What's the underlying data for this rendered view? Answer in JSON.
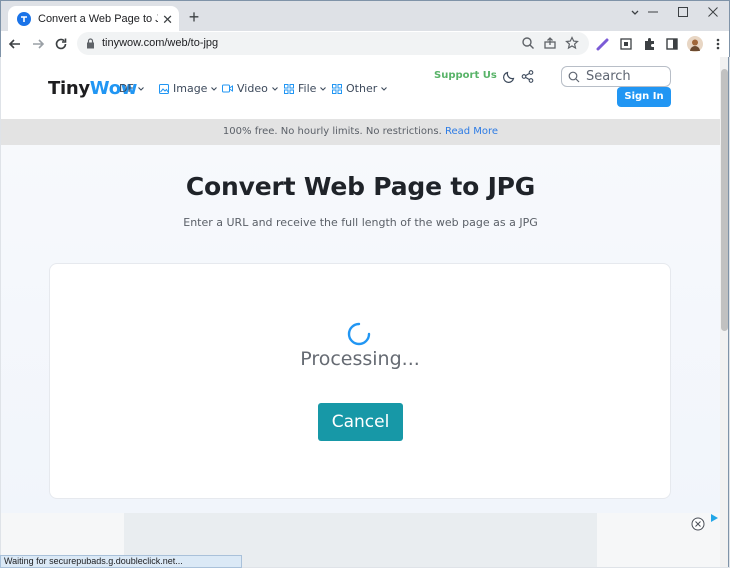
{
  "browser": {
    "tab": {
      "title": "Convert a Web Page to JPG from",
      "close": "✕"
    },
    "new_tab": "+",
    "url": "tinywow.com/web/to-jpg",
    "status_text": "Waiting for securepubads.g.doubleclick.net..."
  },
  "site": {
    "logo": {
      "part1": "Tiny",
      "part2": "Wow"
    },
    "nav": {
      "items": [
        {
          "label": "DF",
          "icon": "pdf-icon"
        },
        {
          "label": "Image",
          "icon": "image-icon"
        },
        {
          "label": "Video",
          "icon": "video-icon"
        },
        {
          "label": "File",
          "icon": "file-icon"
        },
        {
          "label": "Other",
          "icon": "grid-icon"
        }
      ]
    },
    "support": "Support Us",
    "search_label": "Search",
    "signin": "Sign In",
    "banner": {
      "text": "100% free. No hourly limits. No restrictions.",
      "link": "Read More"
    }
  },
  "main": {
    "title": "Convert Web Page to JPG",
    "subtitle": "Enter a URL and receive the full length of the web page as a JPG",
    "status": "Processing...",
    "cancel": "Cancel"
  },
  "colors": {
    "accent": "#2196f3",
    "support": "#58b368",
    "cancel": "#1798a7",
    "link": "#2c7be5"
  }
}
